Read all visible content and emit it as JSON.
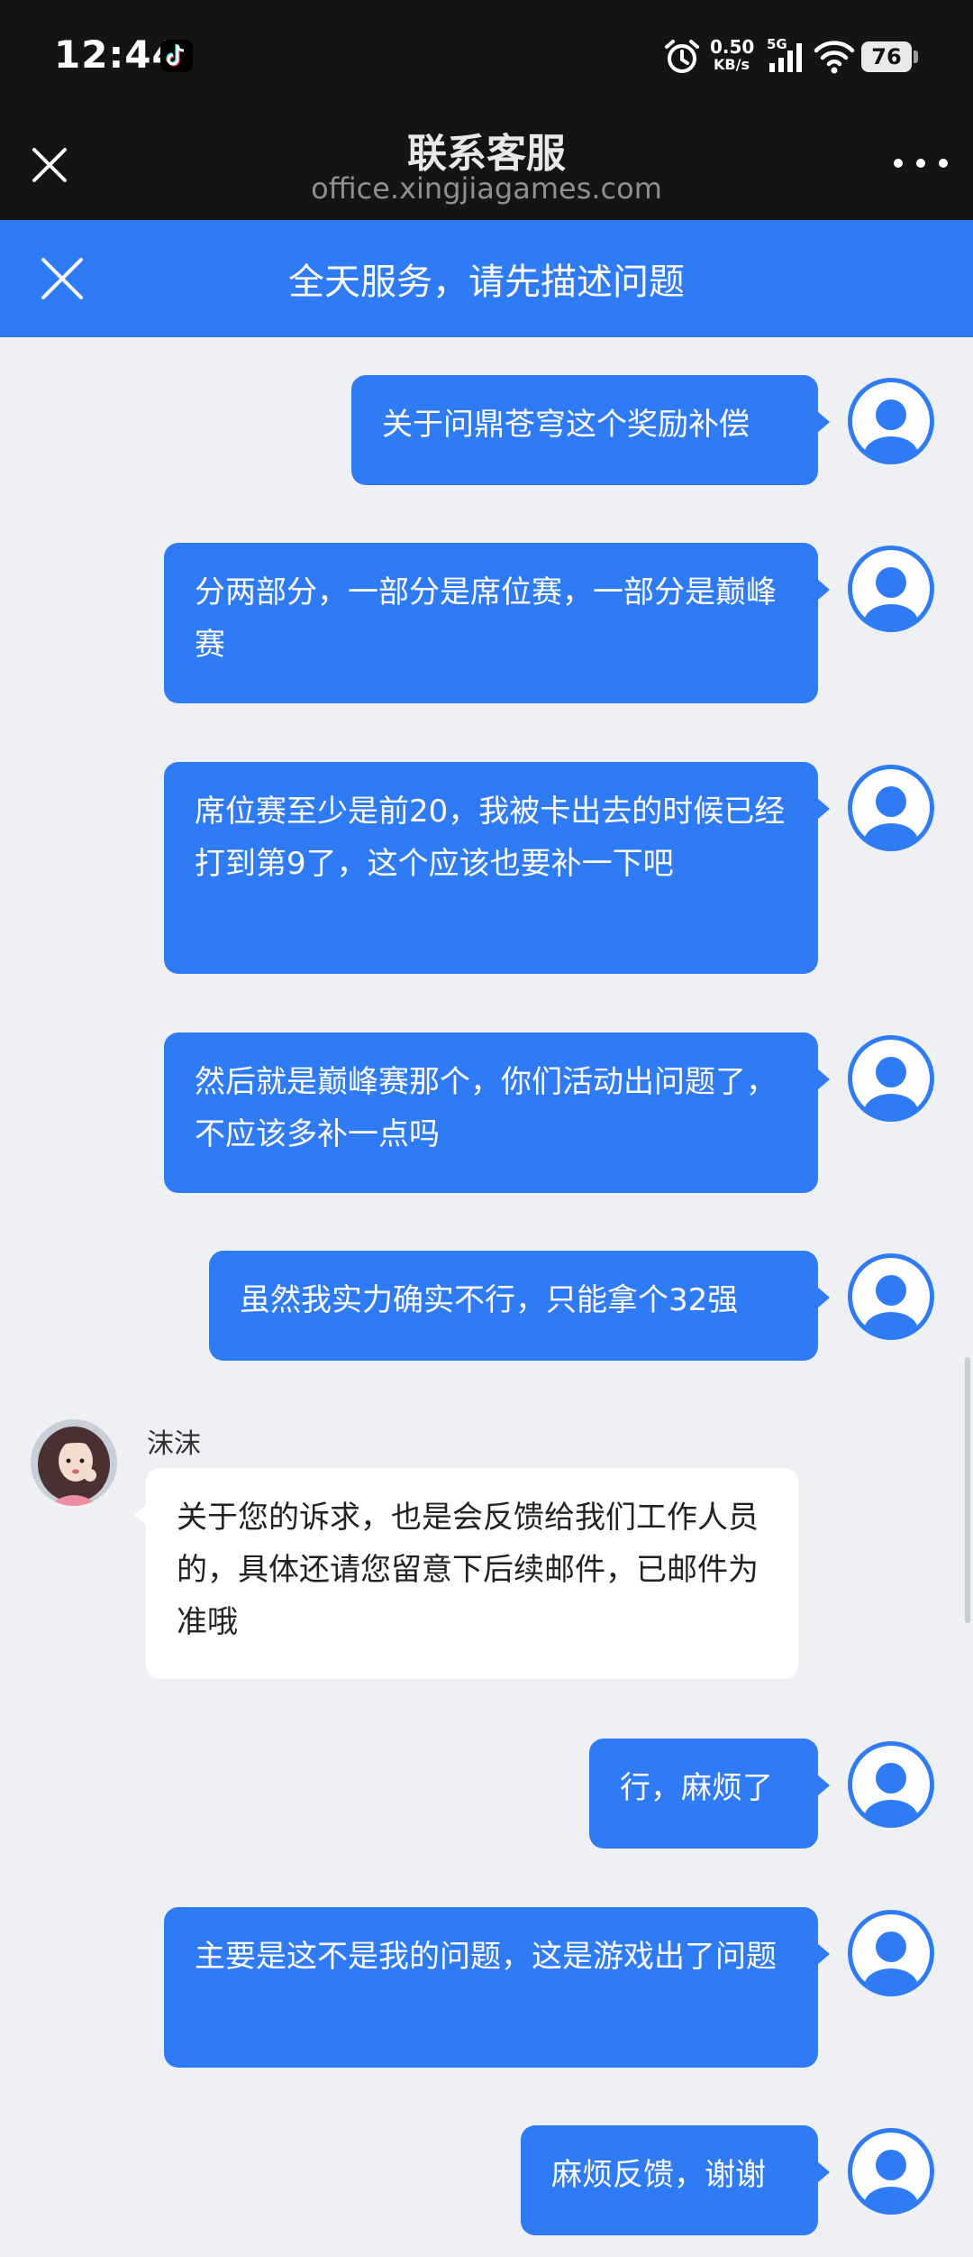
{
  "status_bar": {
    "time": "12:44",
    "net_speed_value": "0.50",
    "net_speed_unit": "KB/s",
    "network_type": "5G",
    "battery": "76"
  },
  "nav": {
    "title": "联系客服",
    "url": "office.xingjiagames.com"
  },
  "banner": {
    "text": "全天服务，请先描述问题"
  },
  "agent": {
    "name": "沫沫",
    "message": "关于您的诉求，也是会反馈给我们工作人员的，具体还请您留意下后续邮件，已邮件为准哦"
  },
  "messages": [
    {
      "text": "关于问鼎苍穹这个奖励补偿"
    },
    {
      "text": "分两部分，一部分是席位赛，一部分是巅峰赛"
    },
    {
      "text": "席位赛至少是前20，我被卡出去的时候已经打到第9了，这个应该也要补一下吧"
    },
    {
      "text": "然后就是巅峰赛那个，你们活动出问题了，不应该多补一点吗"
    },
    {
      "text": "虽然我实力确实不行，只能拿个32强"
    },
    {
      "text": "行，麻烦了"
    },
    {
      "text": "主要是这不是我的问题，这是游戏出了问题"
    },
    {
      "text": "麻烦反馈，谢谢"
    }
  ],
  "colors": {
    "accent": "#2f7bf5",
    "background": "#eef0f3",
    "header": "#141414"
  }
}
